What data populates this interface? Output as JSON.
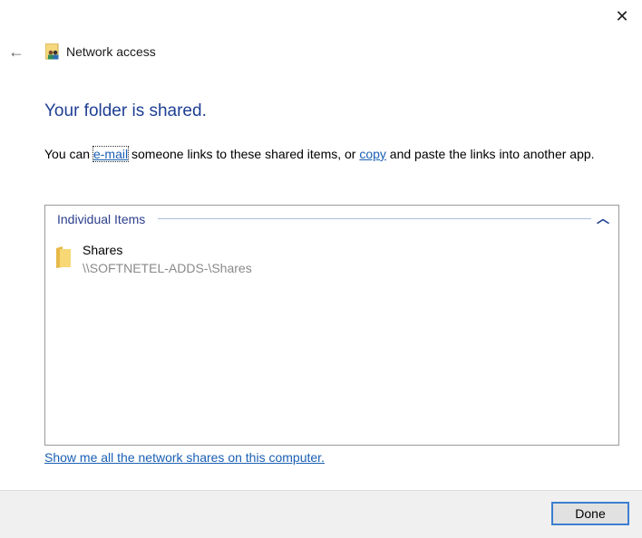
{
  "window": {
    "title": "Network access",
    "close_icon": "close-icon",
    "back_icon": "back-arrow-icon"
  },
  "heading": "Your folder is shared.",
  "description": {
    "part1": "You can ",
    "email_link": "e-mail",
    "part2": " someone links to these shared items, or ",
    "copy_link": "copy",
    "part3": " and paste the links into another app."
  },
  "group": {
    "title": "Individual Items",
    "items": [
      {
        "name": "Shares",
        "path": "\\\\SOFTNETEL-ADDS-\\Shares",
        "icon": "folder-icon"
      }
    ]
  },
  "show_all_link": "Show me all the network shares on this computer.",
  "footer": {
    "done_label": "Done"
  },
  "colors": {
    "heading": "#1f3f94",
    "link": "#1a5fb4",
    "button_border": "#3c7fd0"
  }
}
